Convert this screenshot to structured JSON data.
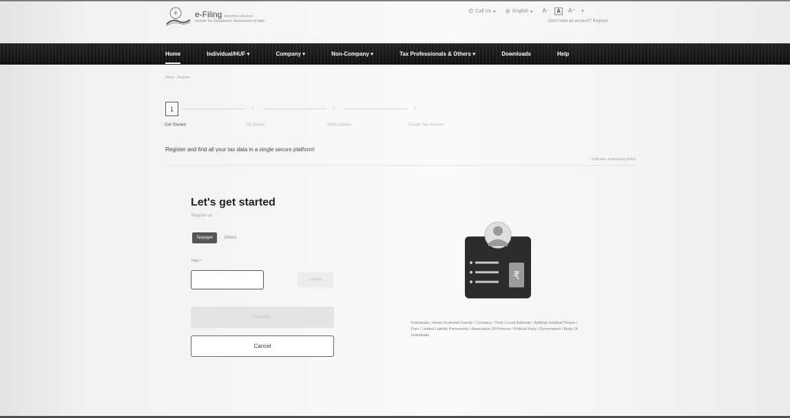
{
  "header": {
    "logo_title": "e-Filing",
    "logo_title_suffix": "Anywhere Anytime",
    "logo_subtitle": "Income Tax Department, Government of India",
    "call_us": "Call Us",
    "language": "English",
    "font_small": "A⁻",
    "font_normal": "A",
    "font_large": "A⁺",
    "sub_text": "Don't have an account? Register"
  },
  "nav": {
    "items": [
      {
        "label": "Home"
      },
      {
        "label": "Individual/HUF ▾"
      },
      {
        "label": "Company ▾"
      },
      {
        "label": "Non-Company ▾"
      },
      {
        "label": "Tax Professionals & Others ▾"
      },
      {
        "label": "Downloads"
      },
      {
        "label": "Help"
      }
    ]
  },
  "breadcrumb": "Home › Register",
  "stepper": {
    "steps": [
      {
        "number": "1",
        "label": "Get Started"
      },
      {
        "number": "2",
        "label": "Fill Details"
      },
      {
        "number": "3",
        "label": "Verify Details"
      },
      {
        "number": "4",
        "label": "Create Tax Account"
      }
    ]
  },
  "tagline": "Register and find all your tax data in a single secure platform!",
  "mandatory_note": "* Indicates mandatory fields",
  "card": {
    "title": "Let's get started",
    "subtitle": "Register as",
    "segment_taxpayer": "Taxpayer",
    "segment_others": "Others",
    "pan_label": "PAN *",
    "pan_value": "",
    "validate_label": "Validate",
    "continue_label": "Continue ›",
    "cancel_label": "Cancel",
    "description": "Individuals / Hindu Undivided Family / Company / Trust / Local Authority / Artificial Juridical Person / Firm / Limited Liability Partnership / Association Of Persons / Political Party / Government / Body Of Individuals"
  },
  "colors": {
    "nav_bg": "#1b1b1b",
    "active_segment": "#555555",
    "illustration_card": "#2c2c2c"
  }
}
